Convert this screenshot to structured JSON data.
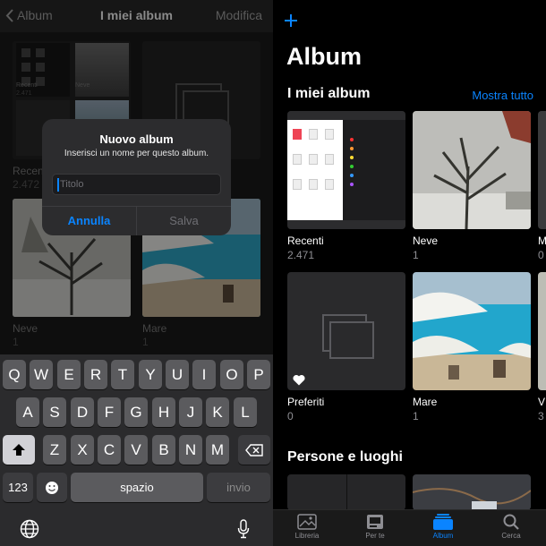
{
  "left": {
    "nav": {
      "back_label": "Album",
      "title": "I miei album",
      "edit_label": "Modifica"
    },
    "albums": [
      {
        "name": "Recenti",
        "count": "2.472"
      },
      {
        "name": "Neve",
        "count": "1"
      },
      {
        "name": "Mare",
        "count": "1"
      }
    ],
    "mini": {
      "recenti": "Recenti",
      "recenti_count": "2.471",
      "neve": "Neve"
    },
    "alert": {
      "title": "Nuovo album",
      "message": "Inserisci un nome per questo album.",
      "placeholder": "Titolo",
      "cancel_label": "Annulla",
      "save_label": "Salva"
    },
    "keyboard": {
      "row1": [
        "Q",
        "W",
        "E",
        "R",
        "T",
        "Y",
        "U",
        "I",
        "O",
        "P"
      ],
      "row2": [
        "A",
        "S",
        "D",
        "F",
        "G",
        "H",
        "J",
        "K",
        "L"
      ],
      "row3": [
        "Z",
        "X",
        "C",
        "V",
        "B",
        "N",
        "M"
      ],
      "numbers_label": "123",
      "space_label": "spazio",
      "return_label": "invio"
    }
  },
  "right": {
    "title": "Album",
    "section_my_albums": "I miei album",
    "see_all": "Mostra tutto",
    "albums": [
      {
        "name": "Recenti",
        "count": "2.471"
      },
      {
        "name": "Neve",
        "count": "1"
      },
      {
        "name": "Preferiti",
        "count": "0"
      },
      {
        "name": "Mare",
        "count": "1"
      }
    ],
    "edge_labels": {
      "top": "M",
      "top_count": "0",
      "bottom": "V",
      "bottom_count": "3"
    },
    "section_people": "Persone e luoghi",
    "tabs": [
      {
        "label": "Libreria",
        "icon": "photos-library-icon"
      },
      {
        "label": "Per te",
        "icon": "for-you-icon"
      },
      {
        "label": "Album",
        "icon": "album-icon",
        "active": true
      },
      {
        "label": "Cerca",
        "icon": "search-icon"
      }
    ],
    "colors": {
      "accent": "#0a84ff",
      "background": "#000000"
    }
  }
}
